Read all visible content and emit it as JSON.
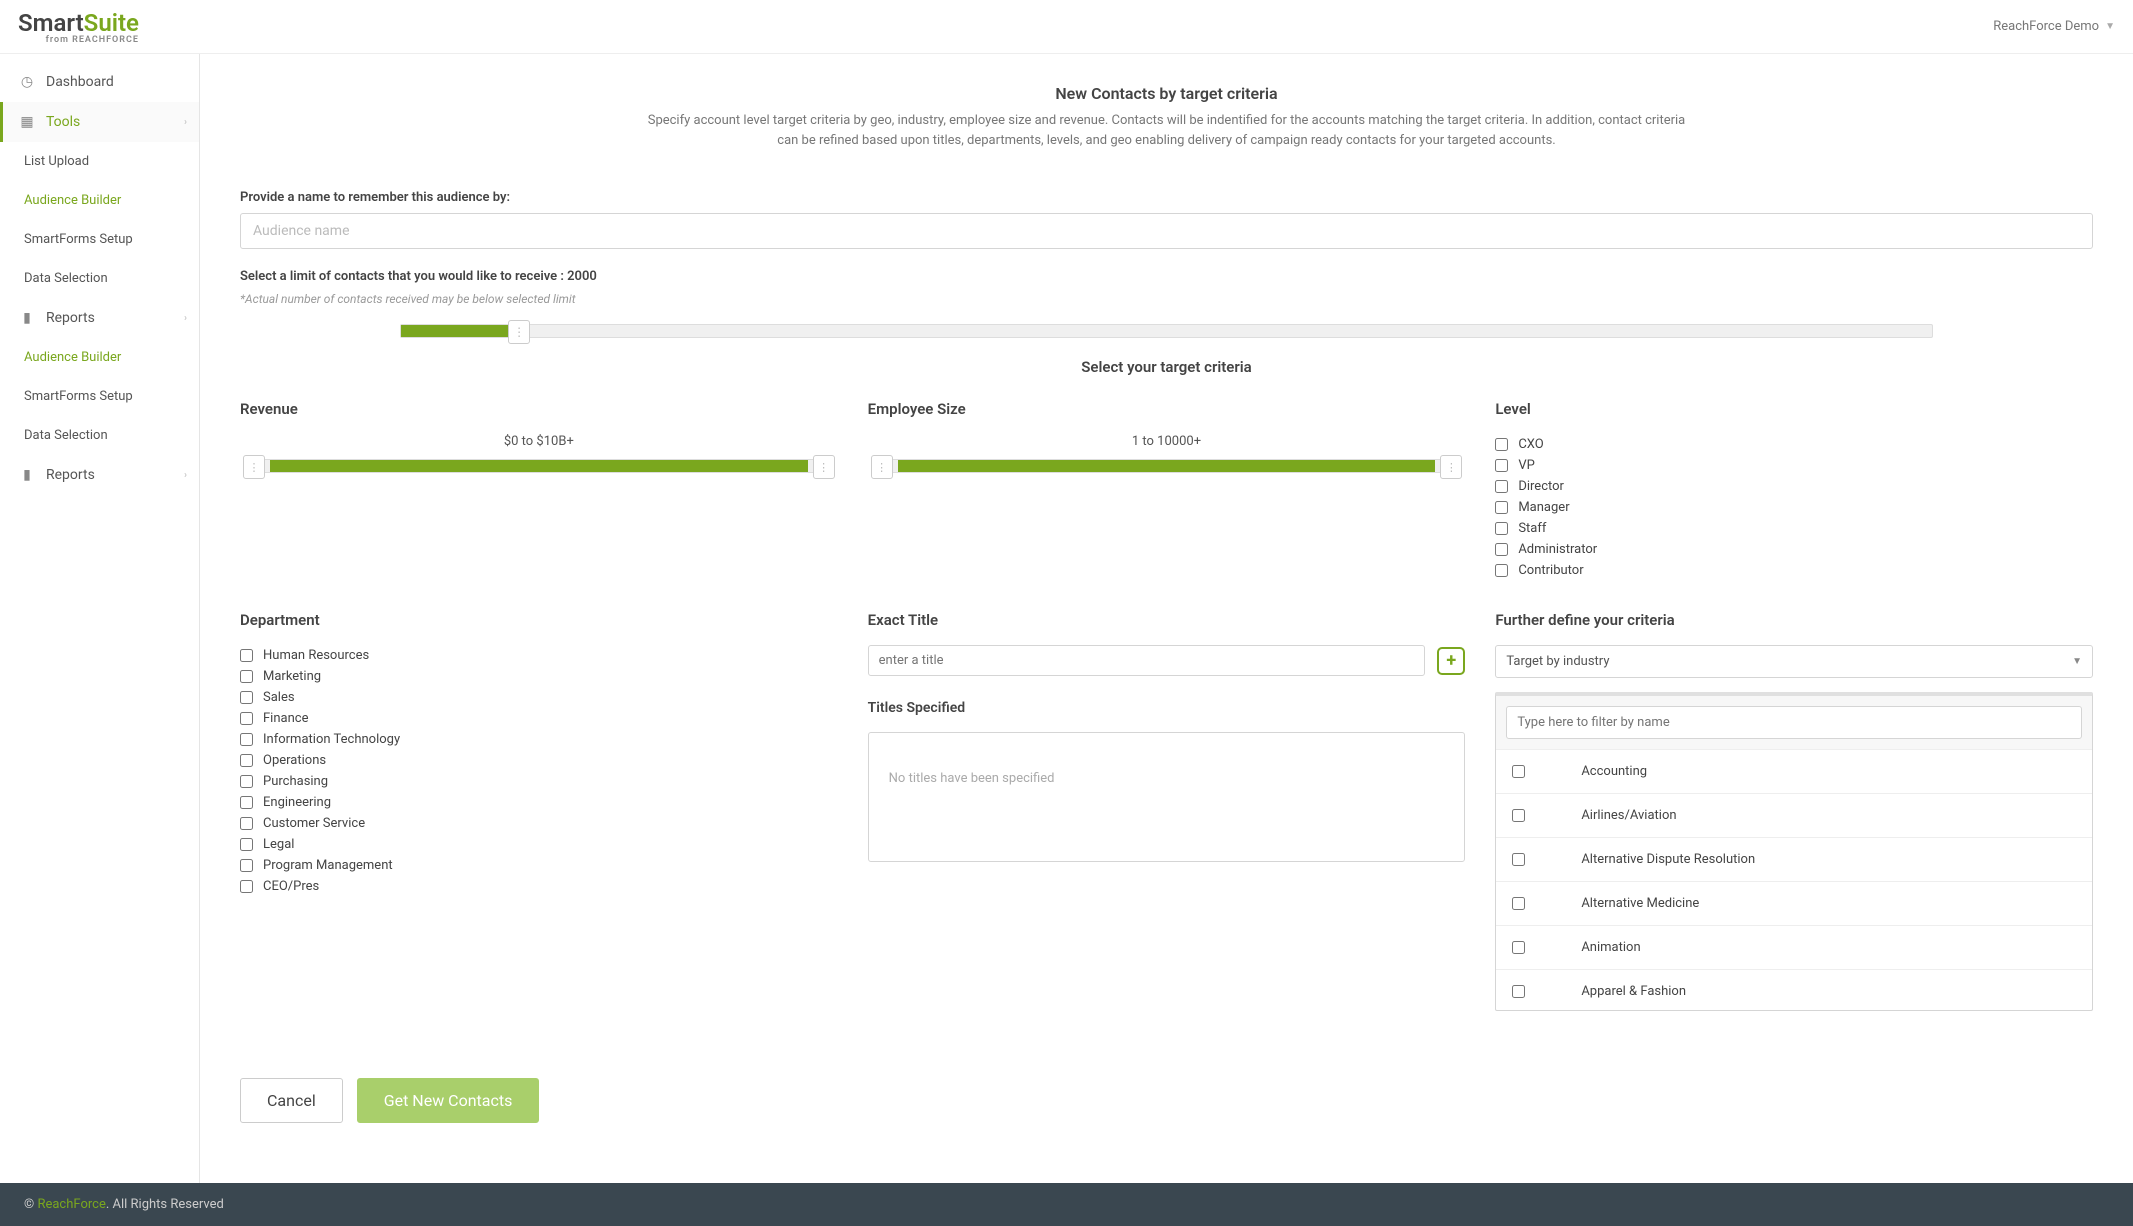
{
  "header": {
    "logo_smart": "Smart",
    "logo_suite": "Suite",
    "logo_sub": "from REACHFORCE",
    "user_label": "ReachForce Demo"
  },
  "sidebar": {
    "dashboard": "Dashboard",
    "tools": "Tools",
    "list_upload": "List Upload",
    "audience_builder": "Audience Builder",
    "smartforms_setup": "SmartForms Setup",
    "data_selection": "Data Selection",
    "reports": "Reports",
    "audience_builder2": "Audience Builder",
    "smartforms_setup2": "SmartForms Setup",
    "data_selection2": "Data Selection",
    "reports2": "Reports"
  },
  "page": {
    "title": "New Contacts by target criteria",
    "desc": "Specify account level target criteria by geo, industry, employee size and revenue. Contacts will be indentified for the accounts matching the target criteria. In addition, contact criteria can be refined based upon titles, departments, levels, and geo enabling delivery of campaign ready contacts for your targeted accounts.",
    "name_label": "Provide a name to remember this audience by:",
    "name_placeholder": "Audience name",
    "limit_label": "Select a limit of contacts that you would like to receive : 2000",
    "limit_note": "*Actual number of contacts received may be below selected limit",
    "section_title": "Select your target criteria"
  },
  "revenue": {
    "head": "Revenue",
    "range": "$0 to $10B+"
  },
  "employee": {
    "head": "Employee Size",
    "range": "1 to 10000+"
  },
  "level": {
    "head": "Level",
    "items": [
      "CXO",
      "VP",
      "Director",
      "Manager",
      "Staff",
      "Administrator",
      "Contributor"
    ]
  },
  "department": {
    "head": "Department",
    "items": [
      "Human Resources",
      "Marketing",
      "Sales",
      "Finance",
      "Information Technology",
      "Operations",
      "Purchasing",
      "Engineering",
      "Customer Service",
      "Legal",
      "Program Management",
      "CEO/Pres"
    ]
  },
  "exact_title": {
    "head": "Exact Title",
    "placeholder": "enter a title",
    "specified_head": "Titles Specified",
    "empty": "No titles have been specified"
  },
  "further": {
    "head": "Further define your criteria",
    "dropdown": "Target by industry",
    "filter_placeholder": "Type here to filter by name",
    "industries": [
      "Accounting",
      "Airlines/Aviation",
      "Alternative Dispute Resolution",
      "Alternative Medicine",
      "Animation",
      "Apparel & Fashion"
    ]
  },
  "buttons": {
    "cancel": "Cancel",
    "get": "Get New Contacts"
  },
  "footer": {
    "copy": "© ",
    "brand": "ReachForce",
    "rest": ". All Rights Reserved"
  }
}
